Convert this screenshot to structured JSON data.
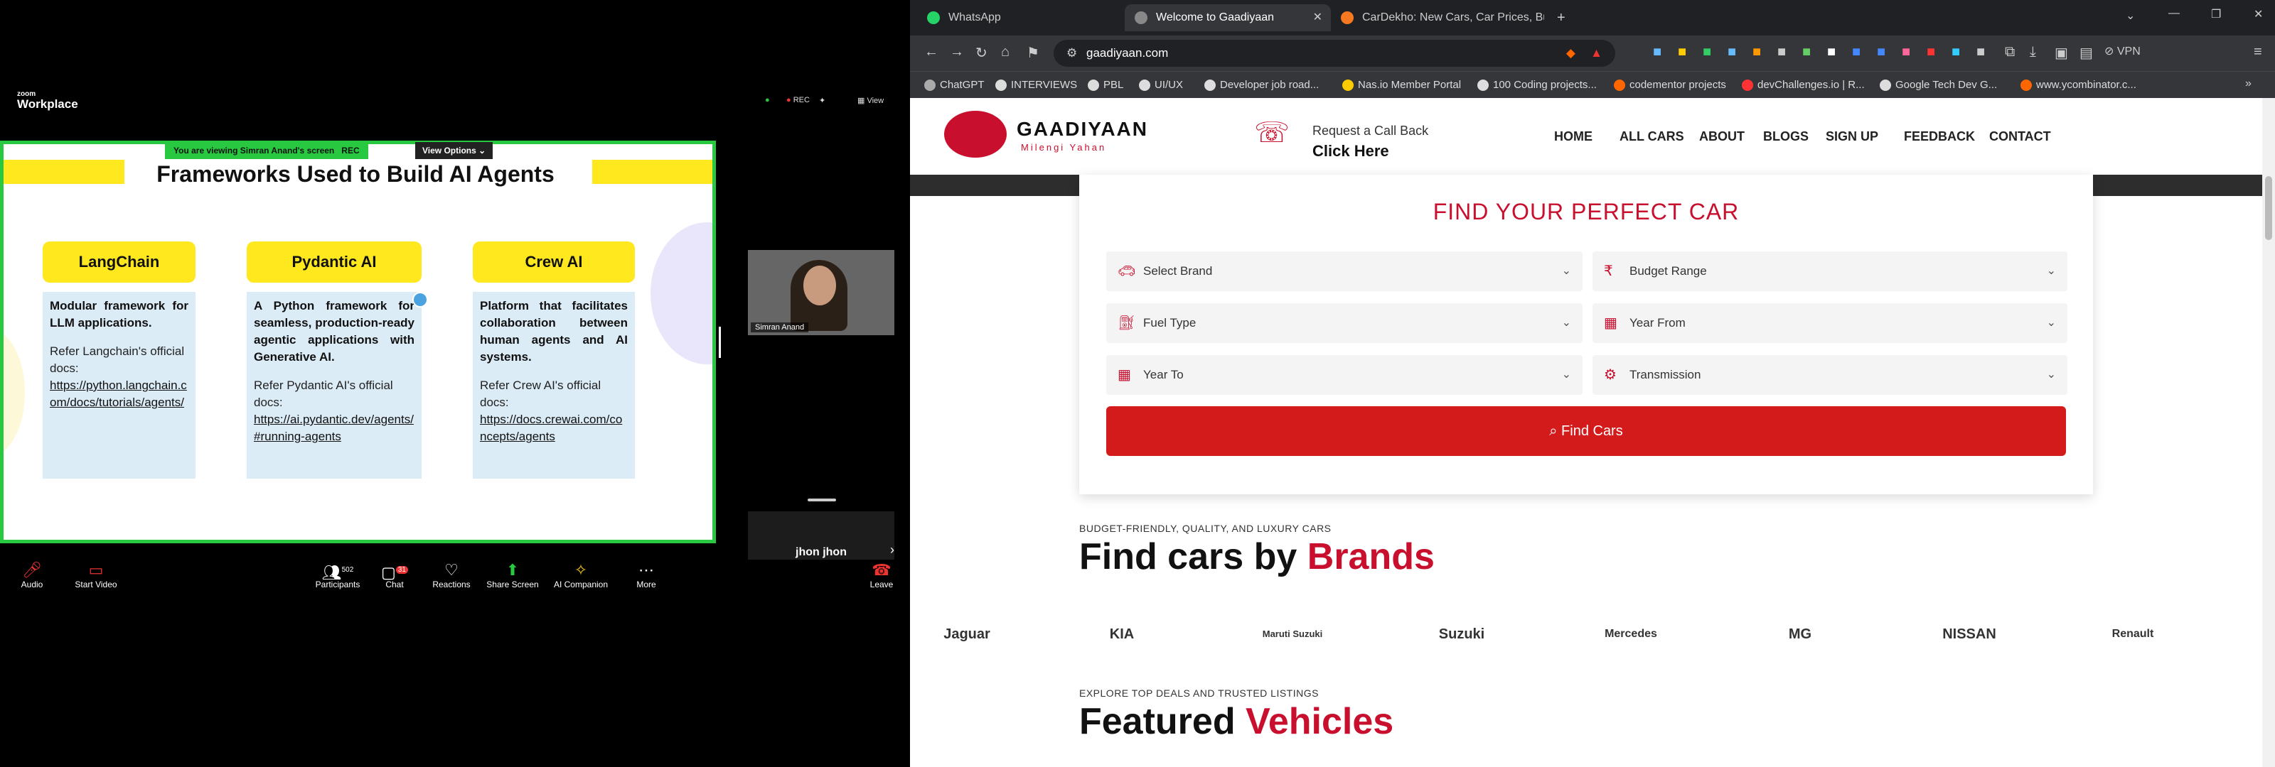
{
  "zoom": {
    "brand_small": "zoom",
    "brand_big": "Workplace",
    "rec": "REC",
    "view_label": "View",
    "banner_viewing": "You are viewing Simran Anand's screen",
    "banner_rec": "REC",
    "view_options": "View Options ⌄",
    "slide": {
      "title": "Frameworks Used to Build AI Agents",
      "cards": [
        {
          "title": "LangChain",
          "desc": "Modular framework for LLM applications.",
          "ref": "Refer Langchain's official docs:",
          "link": "https://python.langchain.com/docs/tutorials/agents/"
        },
        {
          "title": "Pydantic AI",
          "desc": "A Python framework for seamless, production-ready agentic applications with Generative AI.",
          "ref": "Refer Pydantic AI's official docs:",
          "link": "https://ai.pydantic.dev/agents/#running-agents"
        },
        {
          "title": "Crew AI",
          "desc": "Platform that facilitates collaboration between human agents and AI systems.",
          "ref": "Refer Crew AI's official docs:",
          "link": "https://docs.crewai.com/concepts/agents"
        }
      ]
    },
    "participant_name": "Simran Anand",
    "other_participant": "jhon jhon",
    "toolbar": {
      "audio": "Audio",
      "start_video": "Start Video",
      "participants": "Participants",
      "participants_count": "502",
      "chat": "Chat",
      "chat_count": "31",
      "reactions": "Reactions",
      "share_screen": "Share Screen",
      "ai_companion": "AI Companion",
      "more": "More",
      "leave": "Leave"
    }
  },
  "browser": {
    "tabs": [
      {
        "label": "WhatsApp"
      },
      {
        "label": "Welcome to Gaadiyaan"
      },
      {
        "label": "CarDekho: New Cars, Car Prices, Bu..."
      }
    ],
    "url": "gaadiyaan.com",
    "vpn": "VPN",
    "bookmarks": [
      "ChatGPT",
      "INTERVIEWS",
      "PBL",
      "UI/UX",
      "Developer job road...",
      "Nas.io Member Portal",
      "100 Coding projects...",
      "codementor projects",
      "devChallenges.io | R...",
      "Google Tech Dev G...",
      "www.ycombinator.c..."
    ]
  },
  "site": {
    "logo": "GAADIYAAN",
    "tagline": "Milengi Yahan",
    "callback_small": "Request a Call Back",
    "callback_big": "Click Here",
    "nav": [
      "HOME",
      "ALL CARS",
      "ABOUT",
      "BLOGS",
      "SIGN UP",
      "FEEDBACK",
      "CONTACT"
    ],
    "search": {
      "title": "FIND YOUR PERFECT CAR",
      "fields": [
        "Select Brand",
        "Budget Range",
        "Fuel Type",
        "Year From",
        "Year To",
        "Transmission"
      ],
      "button": "Find Cars"
    },
    "brands_kicker": "BUDGET-FRIENDLY, QUALITY, AND LUXURY CARS",
    "brands_h1": "Find cars by ",
    "brands_h2": "Brands",
    "brands": [
      "Jaguar",
      "KIA",
      "Maruti Suzuki",
      "Suzuki",
      "Mercedes",
      "MG",
      "NISSAN",
      "Renault"
    ],
    "featured_kicker": "EXPLORE TOP DEALS AND TRUSTED LISTINGS",
    "featured_h1": "Featured ",
    "featured_h2": "Vehicles"
  }
}
